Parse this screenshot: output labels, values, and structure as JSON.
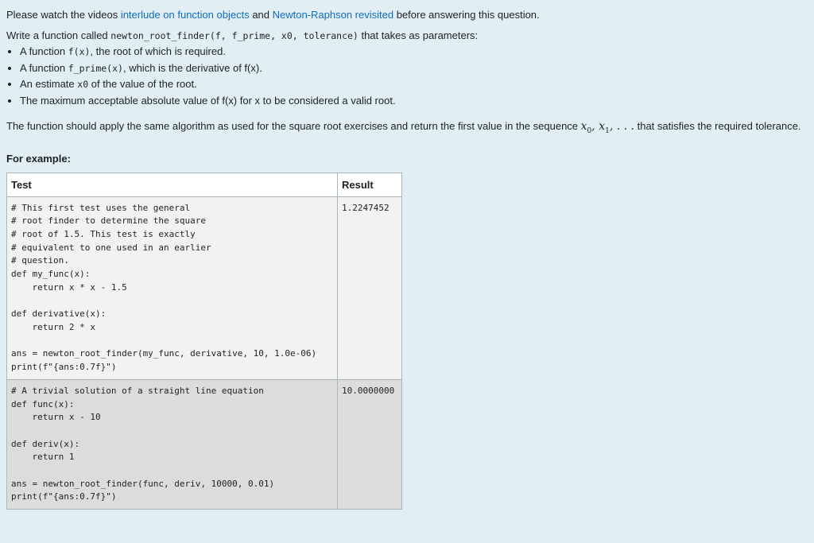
{
  "intro": {
    "prefix": "Please watch the videos ",
    "link1": "interlude on function objects",
    "mid": " and ",
    "link2": "Newton-Raphson revisited",
    "suffix": " before answering this question."
  },
  "task": {
    "prefix": "Write a function called ",
    "signature": "newton_root_finder(f, f_prime, x0, tolerance)",
    "suffix": " that takes as parameters:"
  },
  "params": [
    {
      "pre": "A function ",
      "code": "f(x)",
      "post": ", the root of which is required."
    },
    {
      "pre": "A function ",
      "code": "f_prime(x)",
      "post": ", which is the derivative of f(x)."
    },
    {
      "pre": "An estimate ",
      "code": "x0",
      "post": " of the value of the root."
    },
    {
      "pre": "The maximum acceptable absolute value of f(x) for x to be considered a valid root.",
      "code": "",
      "post": ""
    }
  ],
  "description": {
    "text": "The function should apply the same algorithm as used for the square root exercises and return the first value in the sequence ",
    "math": "x",
    "sub0": "0",
    "sub1": "1",
    "math_sep": ", ",
    "math_tail": ", . . .",
    "suffix": " that satisfies the required tolerance."
  },
  "example_heading": "For example:",
  "table": {
    "headers": [
      "Test",
      "Result"
    ],
    "rows": [
      {
        "test": "# This first test uses the general\n# root finder to determine the square\n# root of 1.5. This test is exactly\n# equivalent to one used in an earlier\n# question.\ndef my_func(x):\n    return x * x - 1.5\n\ndef derivative(x):\n    return 2 * x\n\nans = newton_root_finder(my_func, derivative, 10, 1.0e-06)\nprint(f\"{ans:0.7f}\")",
        "result": "1.2247452"
      },
      {
        "test": "# A trivial solution of a straight line equation\ndef func(x):\n    return x - 10\n\ndef deriv(x):\n    return 1\n\nans = newton_root_finder(func, deriv, 10000, 0.01)\nprint(f\"{ans:0.7f}\")",
        "result": "10.0000000"
      }
    ]
  }
}
